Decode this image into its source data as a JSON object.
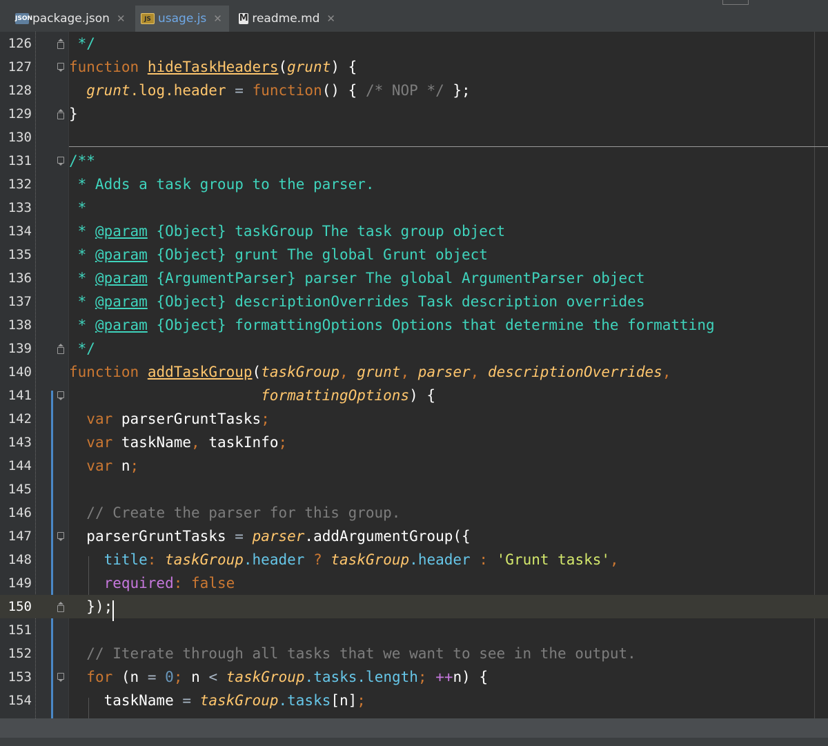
{
  "tabs": [
    {
      "label": "package.json",
      "icon": "JSON",
      "active": false
    },
    {
      "label": "usage.js",
      "icon": "JS",
      "active": true
    },
    {
      "label": "readme.md",
      "icon": "M",
      "active": false
    }
  ],
  "editor": {
    "current_line": "150",
    "lines": [
      {
        "n": "126"
      },
      {
        "n": "127"
      },
      {
        "n": "128"
      },
      {
        "n": "129"
      },
      {
        "n": "130"
      },
      {
        "n": "131"
      },
      {
        "n": "132"
      },
      {
        "n": "133"
      },
      {
        "n": "134"
      },
      {
        "n": "135"
      },
      {
        "n": "136"
      },
      {
        "n": "137"
      },
      {
        "n": "138"
      },
      {
        "n": "139"
      },
      {
        "n": "140"
      },
      {
        "n": "141"
      },
      {
        "n": "142"
      },
      {
        "n": "143"
      },
      {
        "n": "144"
      },
      {
        "n": "145"
      },
      {
        "n": "146"
      },
      {
        "n": "147"
      },
      {
        "n": "148"
      },
      {
        "n": "149"
      },
      {
        "n": "150"
      },
      {
        "n": "151"
      },
      {
        "n": "152"
      },
      {
        "n": "153"
      },
      {
        "n": "154"
      }
    ],
    "code": {
      "l126": " */",
      "l127_kw": "function",
      "l127_fn": "hideTaskHeaders",
      "l127_par": "grunt",
      "l128_obj": "grunt",
      "l128_rest": ".log.header",
      "l128_kw": "function",
      "l128_cm": "/* NOP */",
      "l129": "}",
      "l131": "/**",
      "l132": " * Adds a task group to the parser.",
      "l133": " *",
      "l134_tag": "@param",
      "l134_rest": "{Object} taskGroup The task group object",
      "l135_tag": "@param",
      "l135_rest": "{Object} grunt The global Grunt object",
      "l136_tag": "@param",
      "l136_rest": "{ArgumentParser} parser The global ArgumentParser object",
      "l137_tag": "@param",
      "l137_rest": "{Object} descriptionOverrides Task description overrides",
      "l138_tag": "@param",
      "l138_rest": "{Object} formattingOptions Options that determine the formatting",
      "l139": " */",
      "l140_kw": "function",
      "l140_fn": "addTaskGroup",
      "l140_p1": "taskGroup",
      "l140_p2": "grunt",
      "l140_p3": "parser",
      "l140_p4": "descriptionOverrides",
      "l141_p5": "formattingOptions",
      "l142_kw": "var",
      "l142_id": "parserGruntTasks",
      "l143_kw": "var",
      "l143_id1": "taskName",
      "l143_id2": "taskInfo",
      "l144_kw": "var",
      "l144_id": "n",
      "l146": "// Create the parser for this group.",
      "l147_id": "parserGruntTasks",
      "l147_obj": "parser",
      "l147_meth": ".addArgumentGroup({",
      "l148_key": "title",
      "l148_o1": "taskGroup",
      "l148_p1": ".header",
      "l148_o2": "taskGroup",
      "l148_p2": ".header",
      "l148_str": "'Grunt tasks'",
      "l149_key": "required",
      "l149_val": "false",
      "l150": "});",
      "l152": "// Iterate through all tasks that we want to see in the output.",
      "l153_kw": "for",
      "l153_n1": "n",
      "l153_zero": "0",
      "l153_n2": "n",
      "l153_obj": "taskGroup",
      "l153_p1": ".tasks",
      "l153_p2": ".length",
      "l153_inc": "++",
      "l153_n3": "n",
      "l154_id": "taskName",
      "l154_obj": "taskGroup",
      "l154_p": ".tasks",
      "l154_idx": "[n]"
    }
  },
  "colors": {
    "keyword": "#cc7832",
    "function_name": "#ffc66d",
    "doc_comment": "#3fd4bd",
    "comment": "#7d7d7d",
    "string": "#d4e86c",
    "number": "#6897bb",
    "background": "#2b2b2b"
  }
}
